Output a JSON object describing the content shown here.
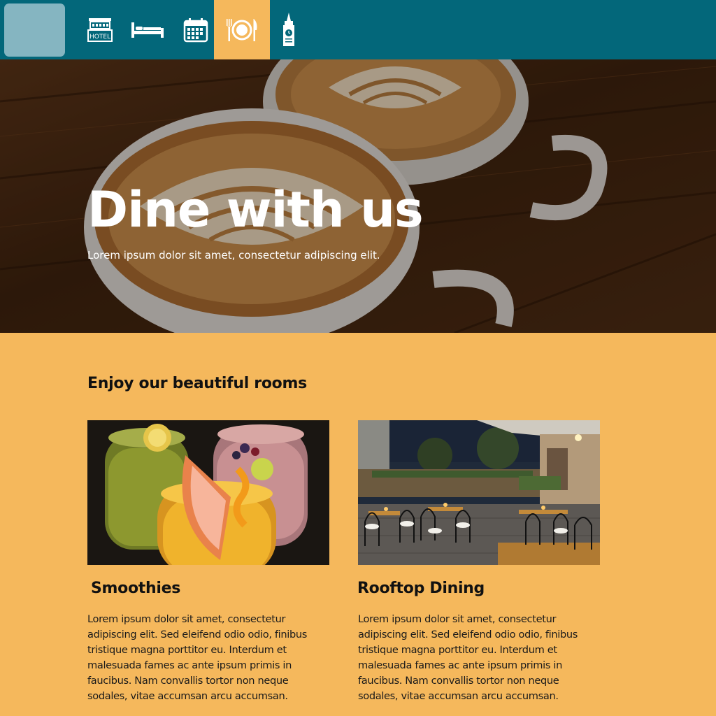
{
  "nav": {
    "logo_icon": "logo-placeholder",
    "items": [
      {
        "id": "hotel",
        "icon": "hotel-icon",
        "label": "HOTEL",
        "active": false
      },
      {
        "id": "rooms",
        "icon": "bed-icon",
        "active": false
      },
      {
        "id": "events",
        "icon": "calendar-icon",
        "active": false
      },
      {
        "id": "dining",
        "icon": "dining-icon",
        "active": true
      },
      {
        "id": "attractions",
        "icon": "big-ben-icon",
        "active": false
      }
    ],
    "colors": {
      "bar": "#03677a",
      "active": "#f5b85c",
      "logo": "#85b5c1"
    }
  },
  "hero": {
    "title": "Dine with us",
    "subtitle": "Lorem ipsum dolor sit amet, consectetur adipiscing elit."
  },
  "content": {
    "heading": "Enjoy our beautiful rooms",
    "cards": [
      {
        "title": "Smoothies",
        "text": "Lorem ipsum dolor sit amet, consectetur adipiscing elit. Sed eleifend odio odio, finibus tristique magna porttitor eu. Interdum et malesuada fames ac ante ipsum primis in faucibus. Nam convallis tortor non neque sodales, vitae accumsan arcu accumsan."
      },
      {
        "title": "Rooftop Dining",
        "text": "Lorem ipsum dolor sit amet, consectetur adipiscing elit. Sed eleifend odio odio, finibus tristique magna porttitor eu. Interdum et malesuada fames ac ante ipsum primis in faucibus. Nam convallis tortor non neque sodales, vitae accumsan arcu accumsan."
      }
    ],
    "background": "#f5b85c"
  }
}
